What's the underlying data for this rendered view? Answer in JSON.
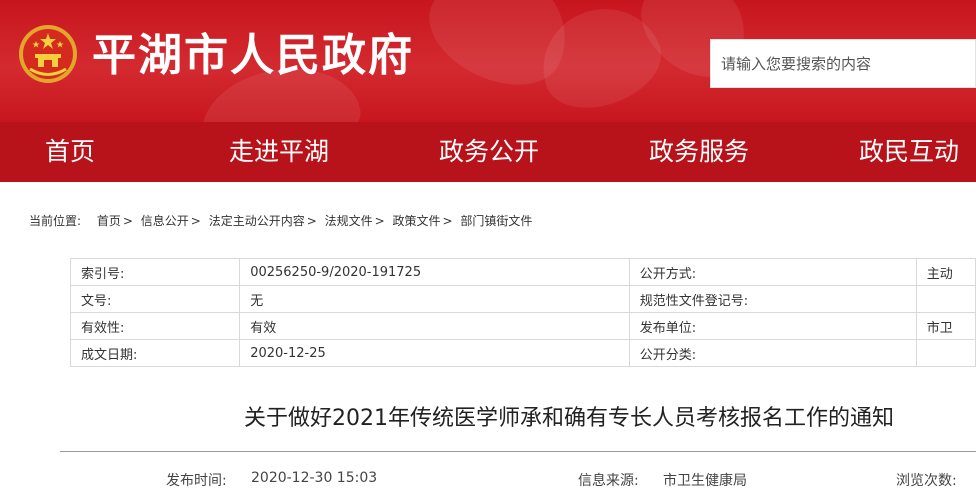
{
  "header": {
    "site_title": "平湖市人民政府",
    "emblem_icon": "national-emblem-icon",
    "search_placeholder": "请输入您要搜索的内容",
    "background_color": "#c8151d"
  },
  "nav": {
    "background_color": "#b8121a",
    "items": [
      {
        "label": "首页"
      },
      {
        "label": "走进平湖"
      },
      {
        "label": "政务公开"
      },
      {
        "label": "政务服务"
      },
      {
        "label": "政民互动"
      }
    ]
  },
  "breadcrumb": {
    "label": "当前位置:",
    "items": [
      {
        "label": "首页"
      },
      {
        "label": "信息公开"
      },
      {
        "label": "法定主动公开内容"
      },
      {
        "label": "法规文件"
      },
      {
        "label": "政策文件"
      },
      {
        "label": "部门镇街文件"
      }
    ],
    "separator": ">"
  },
  "meta": {
    "rows": [
      {
        "k1": "索引号:",
        "v1": "00256250-9/2020-191725",
        "k2": "公开方式:",
        "v2": "主动"
      },
      {
        "k1": "文号:",
        "v1": "无",
        "k2": "规范性文件登记号:",
        "v2": ""
      },
      {
        "k1": "有效性:",
        "v1": "有效",
        "k2": "发布单位:",
        "v2": "市卫"
      },
      {
        "k1": "成文日期:",
        "v1": "2020-12-25",
        "k2": "公开分类:",
        "v2": ""
      }
    ]
  },
  "article": {
    "title": "关于做好2021年传统医学师承和确有专长人员考核报名工作的通知",
    "publish_label": "发布时间:",
    "publish_time": "2020-12-30 15:03",
    "source_label": "信息来源:",
    "source": "市卫生健康局",
    "views_label": "浏览次数:"
  }
}
